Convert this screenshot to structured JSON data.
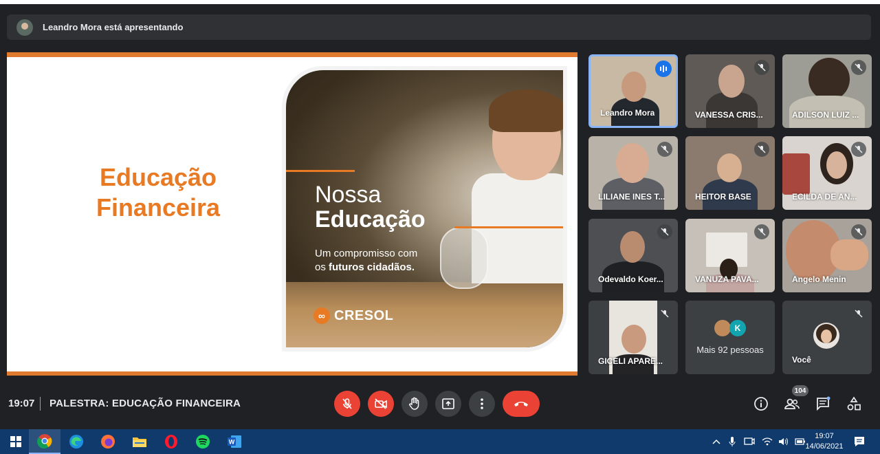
{
  "presenter_bar": {
    "text": "Leandro Mora está apresentando"
  },
  "slide": {
    "title_line1": "Educação",
    "title_line2": "Financeira",
    "headline_light": "Nossa",
    "headline_bold": "Educação",
    "subtitle_line1": "Um compromisso com",
    "subtitle_line2_prefix": "os",
    "subtitle_line2_bold": "futuros cidadãos.",
    "logo_text": "CRESOL"
  },
  "participants": [
    {
      "name": "Leandro Mora",
      "state": "speaking"
    },
    {
      "name": "VANESSA CRIS...",
      "state": "muted"
    },
    {
      "name": "ADILSON LUIZ ...",
      "state": "muted"
    },
    {
      "name": "LILIANE INES T...",
      "state": "muted"
    },
    {
      "name": "HEITOR BASE",
      "state": "muted"
    },
    {
      "name": "ECILDA DE AN...",
      "state": "muted"
    },
    {
      "name": "Odevaldo Koer...",
      "state": "muted"
    },
    {
      "name": "VANUZA PAVA...",
      "state": "muted"
    },
    {
      "name": "Angelo Menin",
      "state": "muted"
    },
    {
      "name": "GICELI APARE...",
      "state": "muted"
    }
  ],
  "more_tile": {
    "avatar_letter": "K",
    "label": "Mais 92 pessoas"
  },
  "self_tile": {
    "name": "Você"
  },
  "meeting_bar": {
    "time": "19:07",
    "title": "PALESTRA: EDUCAÇÃO FINANCEIRA",
    "participants_count": "104"
  },
  "taskbar": {
    "clock_time": "19:07",
    "clock_date": "14/06/2021",
    "apps": [
      "chrome-icon",
      "edge-icon",
      "firefox-icon",
      "file-explorer-icon",
      "opera-icon",
      "spotify-icon",
      "word-icon"
    ]
  },
  "colors": {
    "accent_orange": "#e87a24",
    "end_call_red": "#ea4335",
    "bar_blue": "#0f3a6b"
  }
}
